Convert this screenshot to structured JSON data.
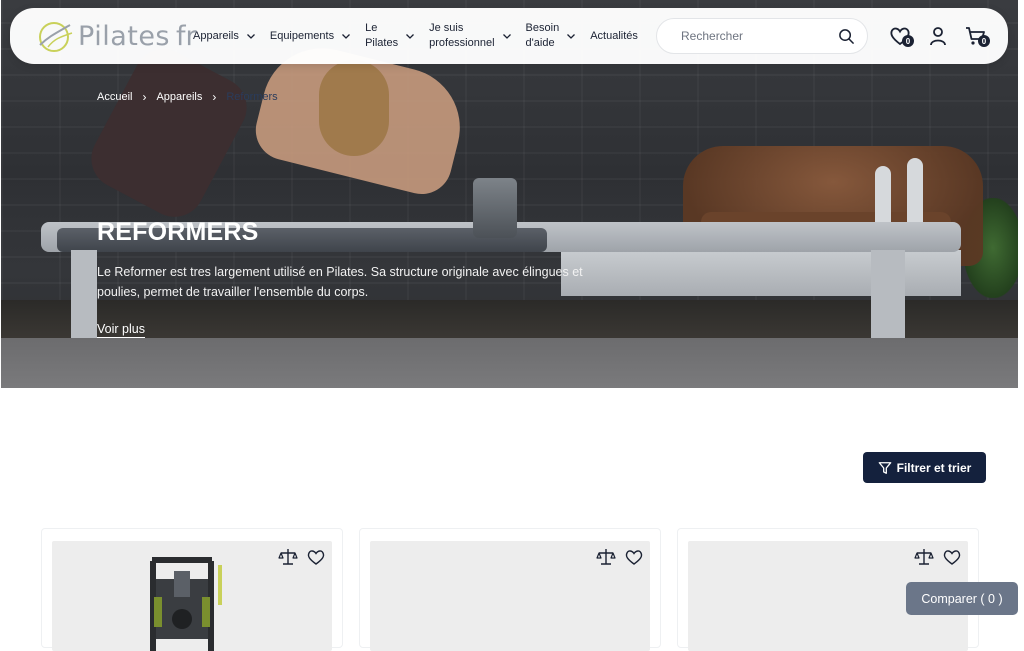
{
  "header": {
    "logo_text": "Pilates",
    "logo_suffix": "fr",
    "nav": [
      {
        "label": "Appareils",
        "has_dropdown": true
      },
      {
        "label": "Equipements",
        "has_dropdown": true
      },
      {
        "label_line1": "Le",
        "label_line2": "Pilates",
        "has_dropdown": true
      },
      {
        "label_line1": "Je suis",
        "label_line2": "professionnel",
        "has_dropdown": true
      },
      {
        "label_line1": "Besoin",
        "label_line2": "d'aide",
        "has_dropdown": true
      },
      {
        "label": "Actualités",
        "has_dropdown": false
      }
    ],
    "search_placeholder": "Rechercher",
    "wishlist_count": "0",
    "cart_count": "0"
  },
  "hero": {
    "breadcrumb": [
      "Accueil",
      "Appareils",
      "Reformers"
    ],
    "title": "REFORMERS",
    "description": "Le Reformer est tres largement utilisé en Pilates. Sa structure originale avec élingues et poulies, permet de travailler l'ensemble du corps.",
    "more_link": "Voir plus"
  },
  "toolbar": {
    "filter_label": "Filtrer et trier"
  },
  "compare": {
    "label": "Comparer ( 0 )"
  },
  "colors": {
    "primary": "#14213d",
    "compare_bg": "#6b7689",
    "card_bg": "#ededed"
  }
}
